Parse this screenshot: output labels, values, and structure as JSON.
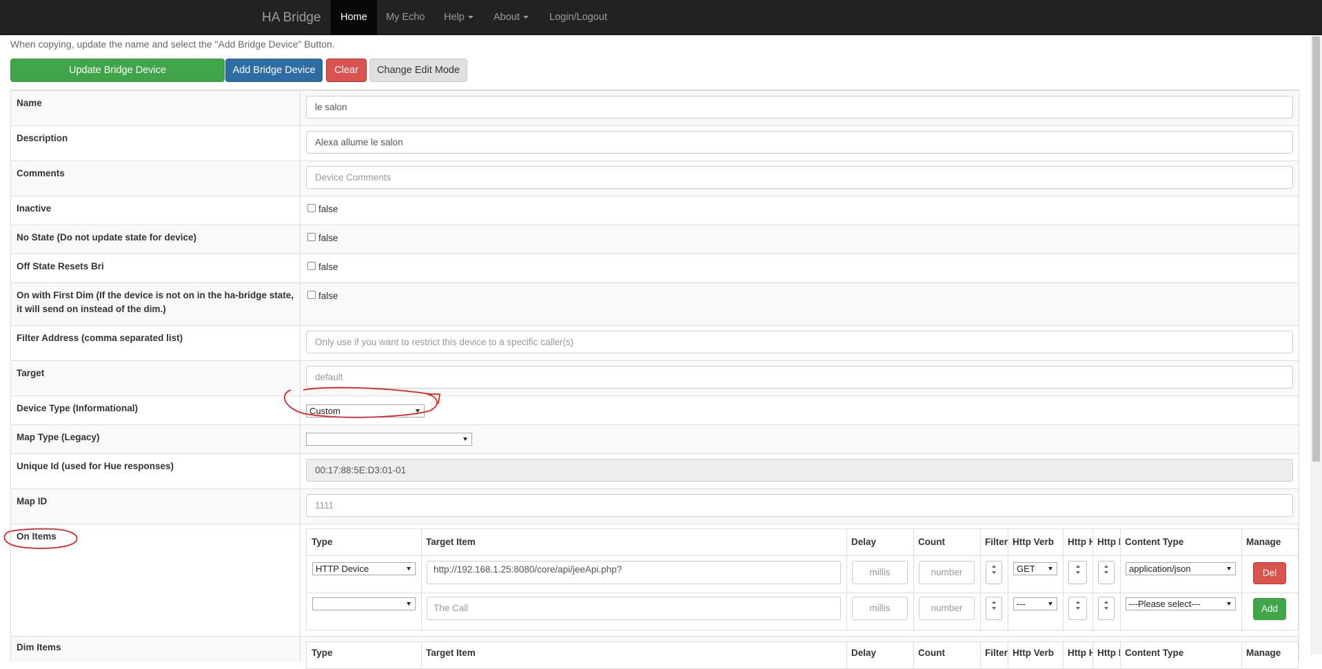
{
  "navbar": {
    "brand": "HA Bridge",
    "items": [
      {
        "label": "Home",
        "active": true
      },
      {
        "label": "My Echo"
      },
      {
        "label": "Help"
      },
      {
        "label": "About"
      },
      {
        "label": "Login/Logout"
      }
    ]
  },
  "hint": "When copying, update the name and select the \"Add Bridge Device\" Button.",
  "toolbar": {
    "update_label": "Update Bridge Device",
    "add_label": "Add Bridge Device",
    "clear_label": "Clear",
    "edit_mode_label": "Change Edit Mode"
  },
  "fields": {
    "name": {
      "label": "Name",
      "value": "le salon"
    },
    "description": {
      "label": "Description",
      "value": "Alexa allume le salon"
    },
    "comments": {
      "label": "Comments",
      "placeholder": "Device Comments"
    },
    "inactive": {
      "label": "Inactive",
      "value": "false"
    },
    "no_state": {
      "label": "No State (Do not update state for device)",
      "value": "false"
    },
    "off_state": {
      "label": "Off State Resets Bri",
      "value": "false"
    },
    "on_first_dim": {
      "label": "On with First Dim (If the device is not on in the ha-bridge state, it will send on instead of the dim.)",
      "value": "false"
    },
    "filter_address": {
      "label": "Filter Address (comma separated list)",
      "placeholder": "Only use if you want to restrict this device to a specific caller(s)"
    },
    "target": {
      "label": "Target",
      "placeholder": "default"
    },
    "device_type": {
      "label": "Device Type (Informational)",
      "value": "Custom"
    },
    "map_type": {
      "label": "Map Type (Legacy)",
      "value": ""
    },
    "unique_id": {
      "label": "Unique Id (used for Hue responses)",
      "value": "00:17:88:5E:D3:01-01"
    },
    "map_id": {
      "label": "Map ID",
      "placeholder": "1111"
    }
  },
  "on_items": {
    "label": "On Items",
    "columns": [
      "Type",
      "Target Item",
      "Delay",
      "Count",
      "Filter",
      "Http Verb",
      "Http H",
      "Http E",
      "Content Type",
      "Manage"
    ],
    "rows": [
      {
        "type": "HTTP Device",
        "target": "http://192.168.1.25:8080/core/api/jeeApi.php?",
        "delay_placeholder": "millis",
        "count_placeholder": "number",
        "verb": "GET",
        "content_type": "application/json",
        "action": "Del"
      },
      {
        "type": "",
        "target_placeholder": "The Call",
        "delay_placeholder": "millis",
        "count_placeholder": "number",
        "verb": "---",
        "content_type": "---Please select---",
        "action": "Add"
      }
    ]
  },
  "dim_items": {
    "label": "Dim Items",
    "columns": [
      "Type",
      "Target Item",
      "Delay",
      "Count",
      "Filter",
      "Http Verb",
      "Http H",
      "Http E",
      "Content Type",
      "Manage"
    ]
  }
}
